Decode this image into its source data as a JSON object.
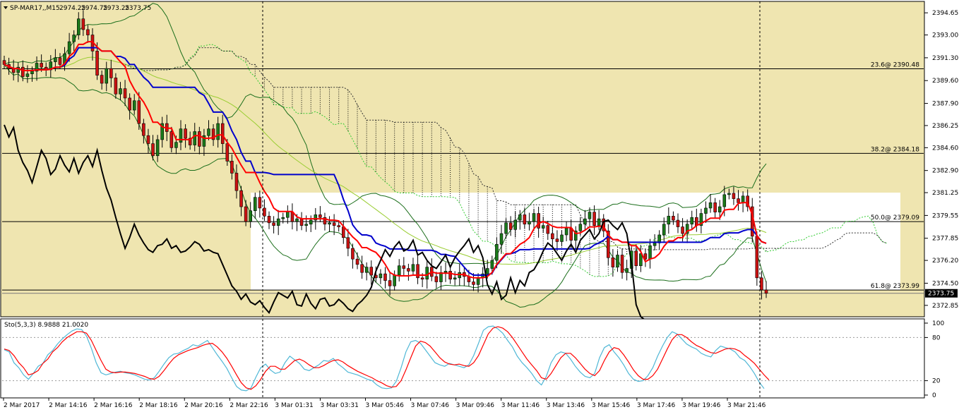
{
  "window": {
    "title": "SP-MAR17,,M15",
    "ohlc": [
      "2974.25",
      "2974.75",
      "2973.25",
      "2373.75"
    ],
    "subwindow_label": "Sto(5,3,3) 8.9888 21.0020"
  },
  "colors": {
    "background": "#efe5b0",
    "fib_zone": "#ffffff",
    "bull_candle": "#1a7a1a",
    "bear_candle": "#cc1111",
    "tenkan": "#ff0000",
    "kijun": "#0000cc",
    "chikou": "#000000",
    "bands": "#1b6e1b",
    "cloud": "#000000",
    "stoch_main": "#4fb7d6",
    "stoch_signal": "#ff0000"
  },
  "chart_data": [
    {
      "type": "candlestick",
      "symbol": "SP-MAR17",
      "timeframe": "M15",
      "ylim": [
        2372.0,
        2395.5
      ],
      "price_ticks": [
        "2394.65",
        "2393.00",
        "2391.30",
        "2389.60",
        "2387.90",
        "2386.25",
        "2384.60",
        "2382.90",
        "2381.25",
        "2379.55",
        "2377.85",
        "2376.20",
        "2374.50",
        "2372.85"
      ],
      "current_price": "2373.75",
      "time_labels": [
        "2 Mar 2017",
        "2 Mar 14:16",
        "2 Mar 16:16",
        "2 Mar 18:16",
        "2 Mar 20:16",
        "2 Mar 22:16",
        "3 Mar 01:31",
        "3 Mar 03:31",
        "3 Mar 05:46",
        "3 Mar 07:46",
        "3 Mar 09:46",
        "3 Mar 11:46",
        "3 Mar 13:46",
        "3 Mar 15:46",
        "3 Mar 17:46",
        "3 Mar 19:46",
        "3 Mar 21:46"
      ],
      "fibonacci": [
        {
          "label": "23.6@ 2390.48",
          "price": 2390.48
        },
        {
          "label": "38.2@ 2384.18",
          "price": 2384.18
        },
        {
          "label": "50.0@ 2379.09",
          "price": 2379.09
        },
        {
          "label": "61.8@ 2373.99",
          "price": 2373.99
        }
      ],
      "candles_close": [
        2390.8,
        2390.5,
        2390.2,
        2390.6,
        2389.9,
        2390.1,
        2390.3,
        2390.9,
        2390.6,
        2390.4,
        2391.0,
        2391.3,
        2390.8,
        2391.6,
        2392.5,
        2393.0,
        2394.2,
        2393.4,
        2393.0,
        2391.8,
        2390.0,
        2389.4,
        2390.5,
        2389.8,
        2388.6,
        2389.0,
        2388.3,
        2387.4,
        2388.1,
        2386.4,
        2385.5,
        2384.9,
        2384.0,
        2385.2,
        2386.4,
        2385.8,
        2384.6,
        2385.0,
        2386.0,
        2385.3,
        2384.8,
        2385.8,
        2384.7,
        2385.5,
        2386.0,
        2385.2,
        2386.4,
        2384.9,
        2383.6,
        2382.7,
        2381.4,
        2380.2,
        2379.1,
        2379.9,
        2380.9,
        2380.1,
        2379.5,
        2379.0,
        2378.8,
        2379.3,
        2379.4,
        2379.8,
        2379.1,
        2379.3,
        2378.8,
        2378.9,
        2379.2,
        2379.6,
        2379.4,
        2378.9,
        2379.0,
        2378.8,
        2378.7,
        2377.9,
        2377.1,
        2376.3,
        2375.9,
        2375.3,
        2375.7,
        2375.1,
        2374.9,
        2375.2,
        2374.7,
        2374.3,
        2375.1,
        2375.8,
        2375.6,
        2375.4,
        2375.9,
        2374.9,
        2374.8,
        2375.7,
        2375.0,
        2374.6,
        2375.3,
        2375.4,
        2374.8,
        2374.9,
        2375.3,
        2375.0,
        2374.6,
        2374.4,
        2374.9,
        2375.2,
        2375.6,
        2376.2,
        2377.4,
        2378.2,
        2379.0,
        2378.5,
        2379.2,
        2379.6,
        2378.9,
        2379.1,
        2379.7,
        2378.6,
        2378.8,
        2378.2,
        2377.8,
        2377.6,
        2378.1,
        2378.6,
        2377.7,
        2378.4,
        2378.9,
        2379.3,
        2379.8,
        2378.8,
        2379.3,
        2378.4,
        2376.4,
        2375.7,
        2376.6,
        2375.3,
        2375.6,
        2376.9,
        2375.8,
        2376.7,
        2376.3,
        2377.3,
        2377.5,
        2378.1,
        2378.9,
        2379.5,
        2379.2,
        2378.7,
        2378.2,
        2378.9,
        2379.4,
        2378.8,
        2379.7,
        2380.1,
        2380.5,
        2379.8,
        2380.2,
        2381.1,
        2381.2,
        2380.8,
        2380.5,
        2381.0,
        2380.2,
        2378.0,
        2374.9,
        2374.0,
        2373.75
      ]
    },
    {
      "type": "line",
      "name": "Sto(5,3,3)",
      "ylim": [
        0,
        100
      ],
      "levels": [
        80,
        20
      ],
      "ticks": [
        "100",
        "80",
        "20",
        "0"
      ],
      "main_last": 8.9888,
      "signal_last": 21.002,
      "main": [
        63,
        60,
        45,
        38,
        28,
        22,
        30,
        40,
        44,
        56,
        62,
        71,
        78,
        84,
        89,
        92,
        91,
        82,
        65,
        45,
        31,
        28,
        30,
        32,
        33,
        31,
        30,
        28,
        25,
        22,
        21,
        24,
        33,
        43,
        52,
        57,
        58,
        62,
        65,
        70,
        68,
        72,
        76,
        66,
        56,
        47,
        37,
        24,
        12,
        7,
        6,
        10,
        25,
        38,
        43,
        35,
        30,
        32,
        45,
        54,
        49,
        44,
        36,
        34,
        38,
        42,
        48,
        47,
        51,
        43,
        38,
        32,
        30,
        28,
        25,
        22,
        20,
        14,
        10,
        9,
        10,
        19,
        38,
        60,
        74,
        76,
        72,
        63,
        54,
        45,
        42,
        40,
        44,
        42,
        40,
        38,
        42,
        55,
        72,
        90,
        95,
        96,
        92,
        86,
        76,
        67,
        54,
        45,
        38,
        30,
        20,
        14,
        26,
        45,
        56,
        60,
        58,
        50,
        40,
        32,
        26,
        24,
        30,
        52,
        66,
        70,
        60,
        52,
        42,
        30,
        22,
        19,
        20,
        27,
        38,
        54,
        68,
        80,
        88,
        85,
        78,
        71,
        67,
        64,
        58,
        55,
        53,
        62,
        68,
        66,
        64,
        60,
        52,
        48,
        40,
        30,
        18,
        9
      ],
      "signal": [
        64,
        62,
        55,
        45,
        38,
        28,
        30,
        34,
        44,
        50,
        60,
        66,
        74,
        80,
        84,
        88,
        88,
        86,
        76,
        62,
        48,
        36,
        32,
        31,
        32,
        32,
        31,
        30,
        28,
        26,
        23,
        22,
        26,
        34,
        43,
        51,
        56,
        59,
        62,
        64,
        66,
        69,
        71,
        72,
        67,
        60,
        51,
        40,
        28,
        17,
        10,
        8,
        13,
        22,
        33,
        40,
        40,
        36,
        36,
        42,
        48,
        50,
        47,
        42,
        38,
        38,
        41,
        45,
        48,
        49,
        46,
        41,
        37,
        33,
        30,
        27,
        24,
        20,
        17,
        13,
        11,
        12,
        20,
        35,
        52,
        68,
        75,
        73,
        68,
        60,
        52,
        46,
        43,
        42,
        43,
        41,
        40,
        45,
        55,
        70,
        85,
        93,
        95,
        93,
        88,
        80,
        70,
        60,
        50,
        42,
        34,
        24,
        22,
        30,
        41,
        52,
        58,
        58,
        52,
        44,
        36,
        30,
        27,
        34,
        48,
        60,
        66,
        64,
        56,
        46,
        35,
        27,
        22,
        22,
        27,
        36,
        50,
        64,
        77,
        84,
        84,
        80,
        74,
        69,
        66,
        62,
        59,
        58,
        61,
        64,
        65,
        64,
        61,
        55,
        50,
        44,
        36,
        28,
        21
      ]
    }
  ]
}
